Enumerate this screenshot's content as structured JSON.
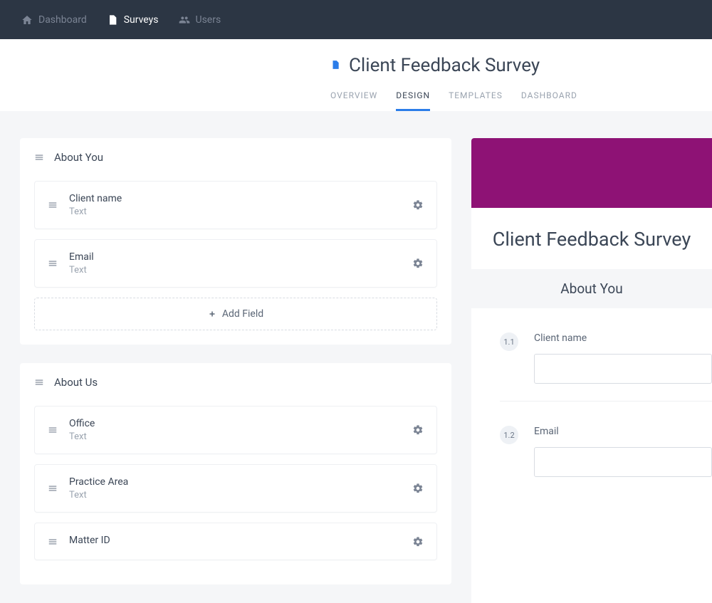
{
  "nav": {
    "dashboard": "Dashboard",
    "surveys": "Surveys",
    "users": "Users"
  },
  "header": {
    "title": "Client Feedback Survey",
    "tabs": {
      "overview": "OVERVIEW",
      "design": "DESIGN",
      "templates": "TEMPLATES",
      "dashboard": "DASHBOARD"
    }
  },
  "sections": [
    {
      "title": "About You",
      "fields": [
        {
          "label": "Client name",
          "type": "Text"
        },
        {
          "label": "Email",
          "type": "Text"
        }
      ],
      "add_label": "Add Field"
    },
    {
      "title": "About Us",
      "fields": [
        {
          "label": "Office",
          "type": "Text"
        },
        {
          "label": "Practice Area",
          "type": "Text"
        },
        {
          "label": "Matter ID",
          "type": ""
        }
      ]
    }
  ],
  "preview": {
    "title": "Client Feedback Survey",
    "section_title": "About You",
    "questions": [
      {
        "num": "1.1",
        "label": "Client name"
      },
      {
        "num": "1.2",
        "label": "Email"
      }
    ]
  },
  "colors": {
    "accent": "#2b7de9",
    "banner": "#8e1275"
  }
}
